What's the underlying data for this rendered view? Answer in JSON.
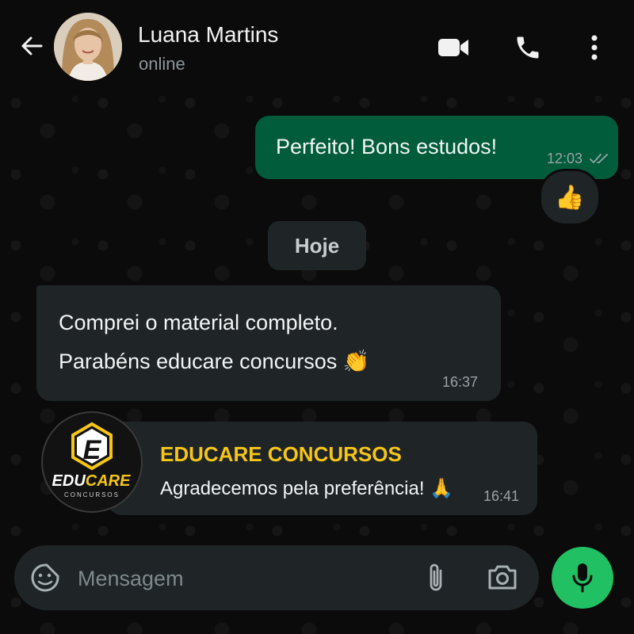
{
  "header": {
    "contact_name": "Luana Martins",
    "status": "online",
    "icons": [
      "back-arrow-icon",
      "video-call-icon",
      "voice-call-icon",
      "more-options-icon"
    ]
  },
  "messages": [
    {
      "direction": "outgoing",
      "text": "Perfeito! Bons estudos!",
      "time": "12:03",
      "status": "read",
      "reaction": "👍"
    },
    {
      "direction": "incoming",
      "lines": [
        "Comprei o material completo.",
        "Parabéns educare concursos 👏"
      ],
      "time": "16:37"
    },
    {
      "direction": "incoming",
      "sender": "EDUCARE CONCURSOS",
      "text": "Agradecemos pela preferência! 🙏",
      "time": "16:41"
    }
  ],
  "date_separator": "Hoje",
  "logo": {
    "letter": "E",
    "brand_left": "EDU",
    "brand_right": "CARE",
    "tagline": "CONCURSOS"
  },
  "composer": {
    "placeholder": "Mensagem"
  },
  "colors": {
    "background": "#0b0b0b",
    "outgoing_bubble": "#005c3b",
    "incoming_bubble": "#1f2426",
    "accent_green": "#21c063",
    "sender_yellow": "#f5c518",
    "read_ticks": "#9aa3a6"
  }
}
